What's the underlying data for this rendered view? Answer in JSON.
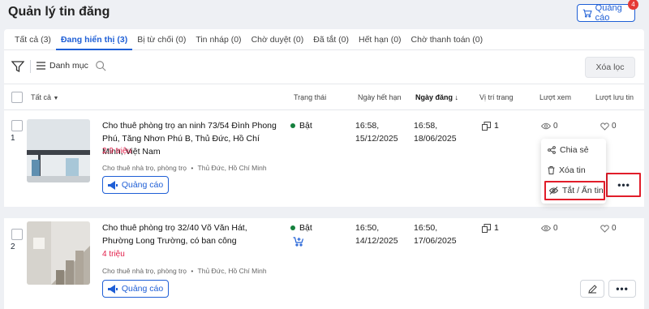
{
  "page": {
    "title": "Quản lý tin đăng"
  },
  "header": {
    "ad_label": "Quảng cáo",
    "badge_count": "4"
  },
  "tabs": [
    {
      "label": "Tất cả (3)"
    },
    {
      "label": "Đang hiển thị (3)",
      "active": true
    },
    {
      "label": "Bị từ chối (0)"
    },
    {
      "label": "Tin nháp (0)"
    },
    {
      "label": "Chờ duyệt (0)"
    },
    {
      "label": "Đã tắt (0)"
    },
    {
      "label": "Hết hạn (0)"
    },
    {
      "label": "Chờ thanh toán (0)"
    }
  ],
  "toolbar": {
    "category_label": "Danh mục",
    "clear_filter_label": "Xóa lọc"
  },
  "table": {
    "headers": {
      "all": "Tất cả",
      "status": "Trạng thái",
      "expiry": "Ngày hết hạn",
      "posted": "Ngày đăng",
      "page_position": "Vị trí trang",
      "views": "Lượt xem",
      "saves": "Lượt lưu tin"
    }
  },
  "listings": [
    {
      "index": "1",
      "title": "Cho thuê phòng trọ an ninh 73/54 Đình Phong Phú, Tăng Nhơn Phú B, Thủ Đức, Hồ Chí Minh, Việt Nam",
      "price": "2.9 triệu",
      "category": "Cho thuê nhà trọ, phòng trọ",
      "location": "Thủ Đức, Hồ Chí Minh",
      "ad_label": "Quảng cáo",
      "status": "Bật",
      "expiry_time": "16:58,",
      "expiry_date": "15/12/2025",
      "posted_time": "16:58,",
      "posted_date": "18/06/2025",
      "position": "1",
      "views": "0",
      "saves": "0"
    },
    {
      "index": "2",
      "title": "Cho thuê phòng trọ 32/40 Võ Văn Hát, Phường Long Trường, có ban công",
      "price": "4 triệu",
      "category": "Cho thuê nhà trọ, phòng trọ",
      "location": "Thủ Đức, Hồ Chí Minh",
      "ad_label": "Quảng cáo",
      "status": "Bật",
      "expiry_time": "16:50,",
      "expiry_date": "14/12/2025",
      "posted_time": "16:50,",
      "posted_date": "17/06/2025",
      "position": "1",
      "views": "0",
      "saves": "0"
    }
  ],
  "context_menu": {
    "items": [
      {
        "label": "Chia sẻ",
        "icon": "share-icon"
      },
      {
        "label": "Xóa tin",
        "icon": "trash-icon"
      },
      {
        "label": "Tắt / Ẩn tin",
        "icon": "eye-off-icon"
      }
    ]
  },
  "colors": {
    "accent": "#1f5fd6",
    "price": "#e11d48",
    "highlight": "#e11d2a",
    "status_on": "#15803d"
  }
}
